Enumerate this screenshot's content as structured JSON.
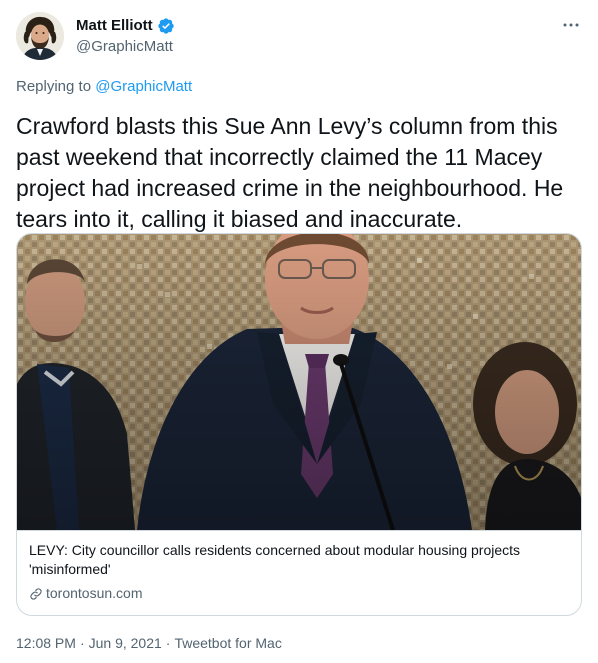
{
  "author": {
    "display_name": "Matt Elliott",
    "handle": "@GraphicMatt",
    "verified": true,
    "avatar_icon": "user-avatar-photo"
  },
  "more_icon": "more-horizontal-icon",
  "reply": {
    "prefix": "Replying to",
    "handle": "@GraphicMatt"
  },
  "tweet_text": "Crawford blasts this Sue Ann Levy’s column from this past weekend that incorrectly claimed the 11 Macey project had increased crime in the neighbourhood. He tears into it, calling it biased and inaccurate.",
  "card": {
    "title": "LEVY: City councillor calls residents concerned about modular housing projects 'misinformed'",
    "domain": "torontosun.com",
    "link_icon": "link-icon"
  },
  "meta": {
    "time": "12:08 PM",
    "separator": "·",
    "date": "Jun 9, 2021",
    "source": "Tweetbot for Mac"
  },
  "colors": {
    "text_primary": "#0f1419",
    "text_secondary": "#536471",
    "link": "#1d9bf0",
    "border": "#cfd9de",
    "verified": "#1d9bf0"
  }
}
